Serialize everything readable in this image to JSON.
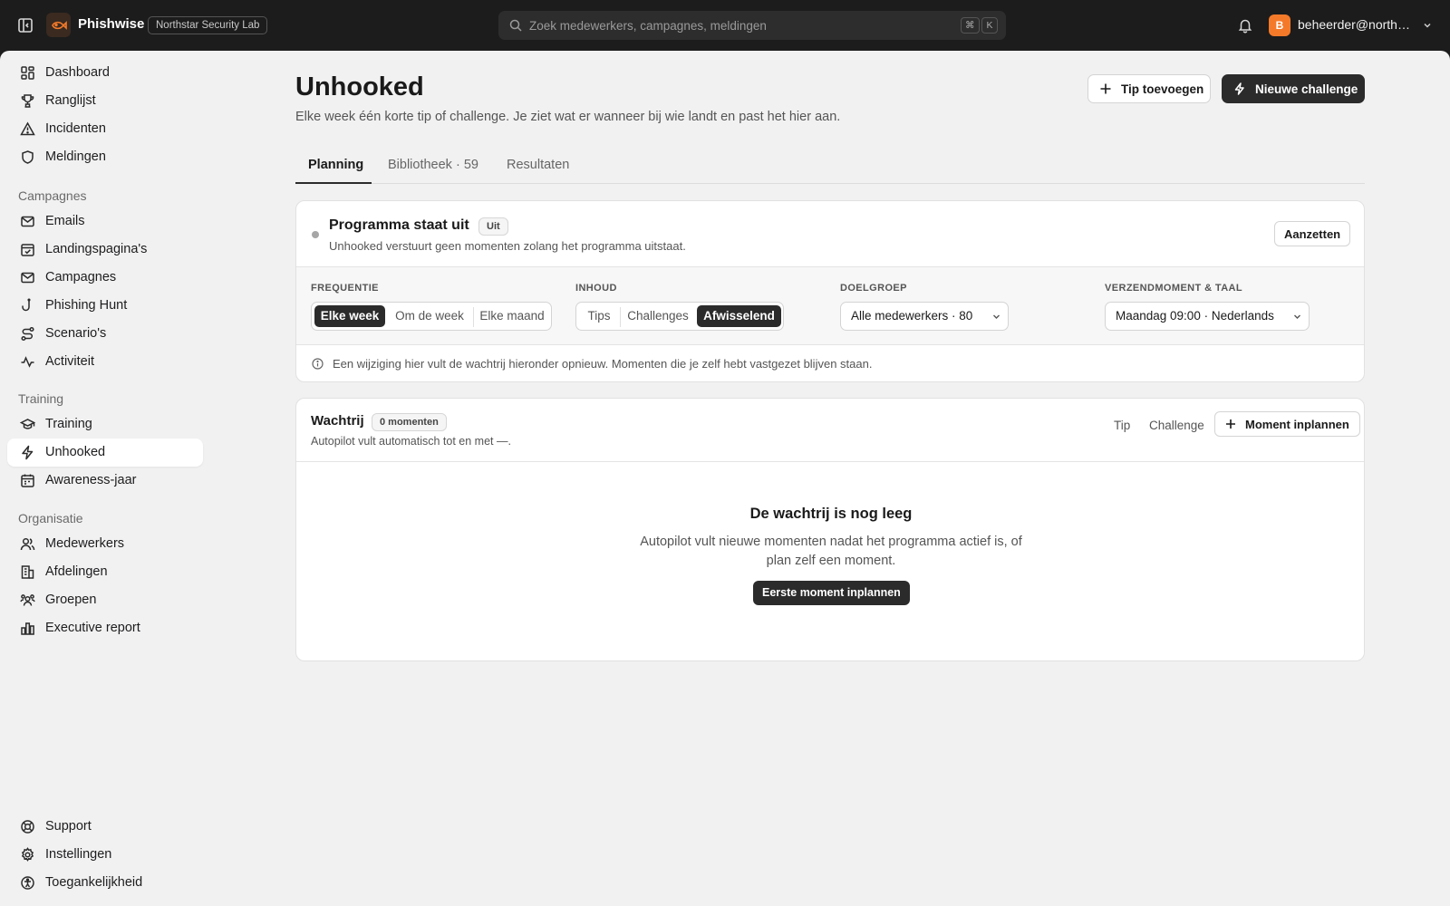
{
  "app": {
    "name": "Phishwise",
    "org": "Northstar Security Lab"
  },
  "search": {
    "placeholder": "Zoek medewerkers, campagnes, meldingen",
    "kbd_mod": "⌘",
    "kbd_key": "K"
  },
  "user": {
    "initial": "B",
    "email": "beheerder@northst...",
    "avatar_color": "#f47a2a"
  },
  "sidebar": {
    "top": [
      {
        "label": "Dashboard",
        "icon": "grid-icon"
      },
      {
        "label": "Ranglijst",
        "icon": "trophy-icon"
      },
      {
        "label": "Incidenten",
        "icon": "alert-triangle-icon"
      },
      {
        "label": "Meldingen",
        "icon": "shield-icon"
      }
    ],
    "section_campagnes": "Campagnes",
    "campagnes": [
      {
        "label": "Emails",
        "icon": "mail-icon"
      },
      {
        "label": "Landingspagina's",
        "icon": "calendar-check-icon"
      },
      {
        "label": "Campagnes",
        "icon": "mail-icon"
      },
      {
        "label": "Phishing Hunt",
        "icon": "fish-hook-icon"
      },
      {
        "label": "Scenario's",
        "icon": "route-icon"
      },
      {
        "label": "Activiteit",
        "icon": "activity-icon"
      }
    ],
    "section_training": "Training",
    "training": [
      {
        "label": "Training",
        "icon": "graduation-cap-icon"
      },
      {
        "label": "Unhooked",
        "icon": "zap-icon",
        "active": true
      },
      {
        "label": "Awareness-jaar",
        "icon": "calendar-icon"
      }
    ],
    "section_organisatie": "Organisatie",
    "organisatie": [
      {
        "label": "Medewerkers",
        "icon": "users-icon"
      },
      {
        "label": "Afdelingen",
        "icon": "building-icon"
      },
      {
        "label": "Groepen",
        "icon": "user-group-icon"
      },
      {
        "label": "Executive report",
        "icon": "bar-chart-icon"
      }
    ],
    "bottom": [
      {
        "label": "Support",
        "icon": "lifebuoy-icon"
      },
      {
        "label": "Instellingen",
        "icon": "gear-icon"
      },
      {
        "label": "Toegankelijkheid",
        "icon": "accessibility-icon"
      }
    ]
  },
  "page": {
    "title": "Unhooked",
    "subtitle": "Elke week één korte tip of challenge. Je ziet wat er wanneer bij wie landt en past het hier aan.",
    "add_tip": "Tip toevoegen",
    "new_challenge": "Nieuwe challenge"
  },
  "tabs": [
    {
      "label": "Planning",
      "active": true
    },
    {
      "label": "Bibliotheek · 59"
    },
    {
      "label": "Resultaten"
    }
  ],
  "program": {
    "title": "Programma staat uit",
    "badge": "Uit",
    "subtitle": "Unhooked verstuurt geen momenten zolang het programma uitstaat.",
    "toggle_button": "Aanzetten"
  },
  "settings": {
    "frequency": {
      "label": "FREQUENTIE",
      "options": [
        "Elke week",
        "Om de week",
        "Elke maand"
      ],
      "selected": "Elke week"
    },
    "content": {
      "label": "INHOUD",
      "options": [
        "Tips",
        "Challenges",
        "Afwisselend"
      ],
      "selected": "Afwisselend"
    },
    "audience": {
      "label": "DOELGROEP",
      "value": "Alle medewerkers · 80"
    },
    "schedule": {
      "label": "VERZENDMOMENT & TAAL",
      "value": "Maandag 09:00 · Nederlands"
    },
    "note": "Een wijziging hier vult de wachtrij hieronder opnieuw. Momenten die je zelf hebt vastgezet blijven staan."
  },
  "queue": {
    "title": "Wachtrij",
    "badge": "0 momenten",
    "subtitle": "Autopilot vult automatisch tot en met —.",
    "filter_tip": "Tip",
    "filter_challenge": "Challenge",
    "plan_button": "Moment inplannen",
    "empty_title": "De wachtrij is nog leeg",
    "empty_text": "Autopilot vult nieuwe momenten nadat het programma actief is, of plan zelf een moment.",
    "empty_button": "Eerste moment inplannen"
  }
}
